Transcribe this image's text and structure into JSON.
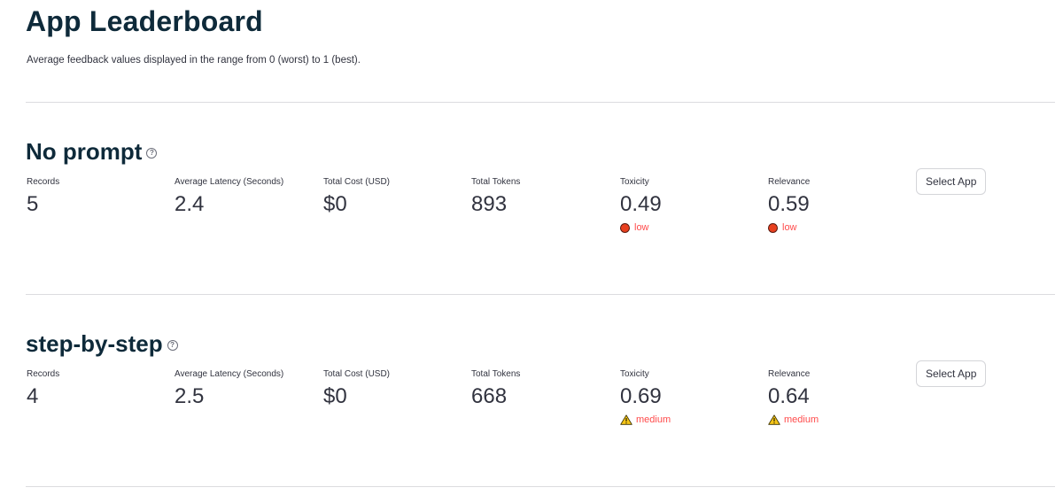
{
  "page": {
    "title": "App Leaderboard",
    "subtitle": "Average feedback values displayed in the range from 0 (worst) to 1 (best)."
  },
  "labels": {
    "records": "Records",
    "latency": "Average Latency (Seconds)",
    "cost": "Total Cost (USD)",
    "tokens": "Total Tokens",
    "toxicity": "Toxicity",
    "relevance": "Relevance",
    "select": "Select App",
    "help_glyph": "?"
  },
  "apps": [
    {
      "name": "No prompt",
      "records": "5",
      "latency": "2.4",
      "cost": "$0",
      "tokens": "893",
      "toxicity": "0.49",
      "toxicity_status": "low",
      "toxicity_icon": "red-circle-icon",
      "relevance": "0.59",
      "relevance_status": "low",
      "relevance_icon": "red-circle-icon"
    },
    {
      "name": "step-by-step",
      "records": "4",
      "latency": "2.5",
      "cost": "$0",
      "tokens": "668",
      "toxicity": "0.69",
      "toxicity_status": "medium",
      "toxicity_icon": "warning-icon",
      "relevance": "0.64",
      "relevance_status": "medium",
      "relevance_icon": "warning-icon"
    }
  ],
  "colors": {
    "heading": "#0e2a3a",
    "status_text": "#ff4b4b",
    "low_dot": "#e8401f",
    "warning_fill": "#f5c518"
  }
}
